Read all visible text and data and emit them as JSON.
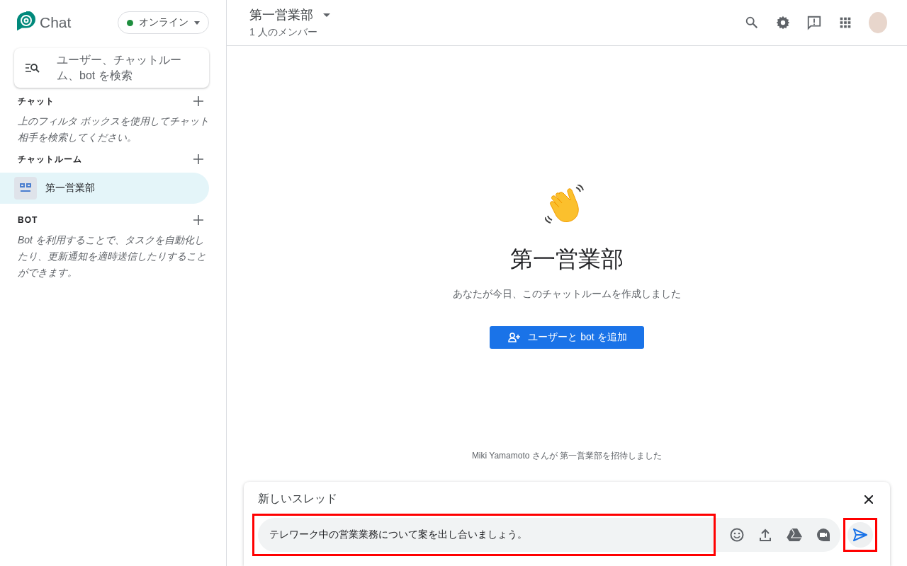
{
  "app": {
    "name": "Chat"
  },
  "status": {
    "label": "オンライン",
    "color": "#1e8e3e"
  },
  "search": {
    "placeholder": "ユーザー、チャットルーム、bot を検索"
  },
  "sections": [
    {
      "kind": "hint",
      "title": "チャット",
      "hint": "上のフィルタ ボックスを使用してチャット相手を検索してください。"
    },
    {
      "kind": "rooms",
      "title": "チャットルーム",
      "items": [
        {
          "name": "第一営業部",
          "selected": true
        }
      ]
    },
    {
      "kind": "hint",
      "title": "BOT",
      "hint": "Bot を利用することで、タスクを自動化したり、更新通知を適時送信したりすることができます。"
    }
  ],
  "header": {
    "title": "第一営業部",
    "subtitle": "1 人のメンバー"
  },
  "welcome": {
    "title": "第一営業部",
    "subtitle": "あなたが今日、このチャットルームを作成しました",
    "button": "ユーザーと bot を追加"
  },
  "system_message": "Miki Yamamoto さんが 第一営業部を招待しました",
  "compose": {
    "title": "新しいスレッド",
    "message": "テレワーク中の営業業務について案を出し合いましょう。",
    "message_highlighted": true,
    "send_highlighted": true
  }
}
